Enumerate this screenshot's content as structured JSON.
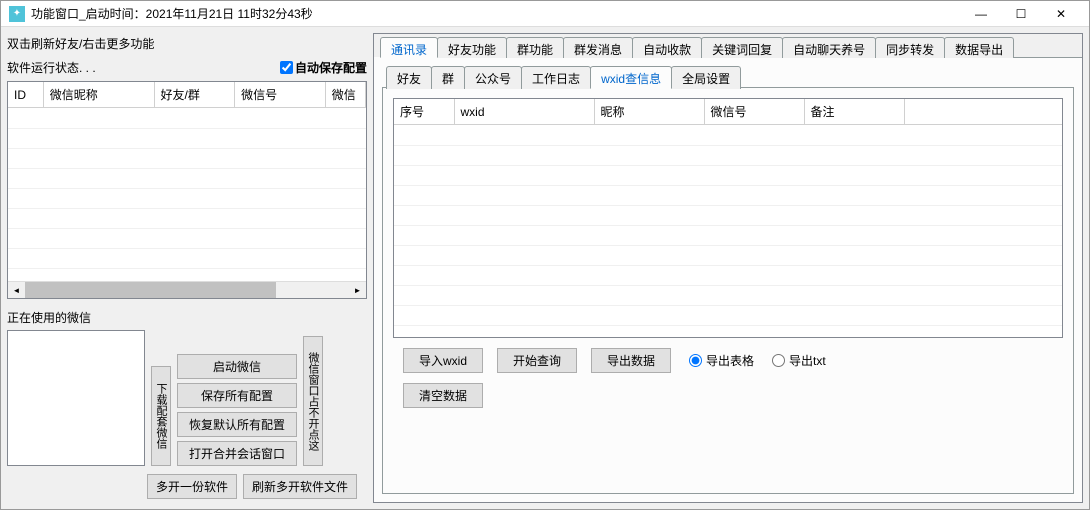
{
  "title": "功能窗口_启动时间：2021年11月21日 11时32分43秒",
  "hint": "双击刷新好友/右击更多功能",
  "status": "软件运行状态. . .",
  "autosave": "自动保存配置",
  "left_table": {
    "headers": [
      "ID",
      "微信昵称",
      "好友/群",
      "微信号",
      "微信"
    ]
  },
  "using_label": "正在使用的微信",
  "v_btn1": "下载配套微信",
  "v_btn2": "微信窗口占不开点这",
  "stack": [
    "启动微信",
    "保存所有配置",
    "恢复默认所有配置",
    "打开合并会话窗口"
  ],
  "bottom2": [
    "多开一份软件",
    "刷新多开软件文件"
  ],
  "main_tabs": [
    "通讯录",
    "好友功能",
    "群功能",
    "群发消息",
    "自动收款",
    "关键词回复",
    "自动聊天养号",
    "同步转发",
    "数据导出"
  ],
  "sub_tabs": [
    "好友",
    "群",
    "公众号",
    "工作日志",
    "wxid查信息",
    "全局设置"
  ],
  "right_table": {
    "headers": [
      "序号",
      "wxid",
      "昵称",
      "微信号",
      "备注"
    ]
  },
  "actions": {
    "import": "导入wxid",
    "query": "开始查询",
    "export": "导出数据",
    "exp_tbl": "导出表格",
    "exp_txt": "导出txt",
    "clear": "清空数据"
  }
}
